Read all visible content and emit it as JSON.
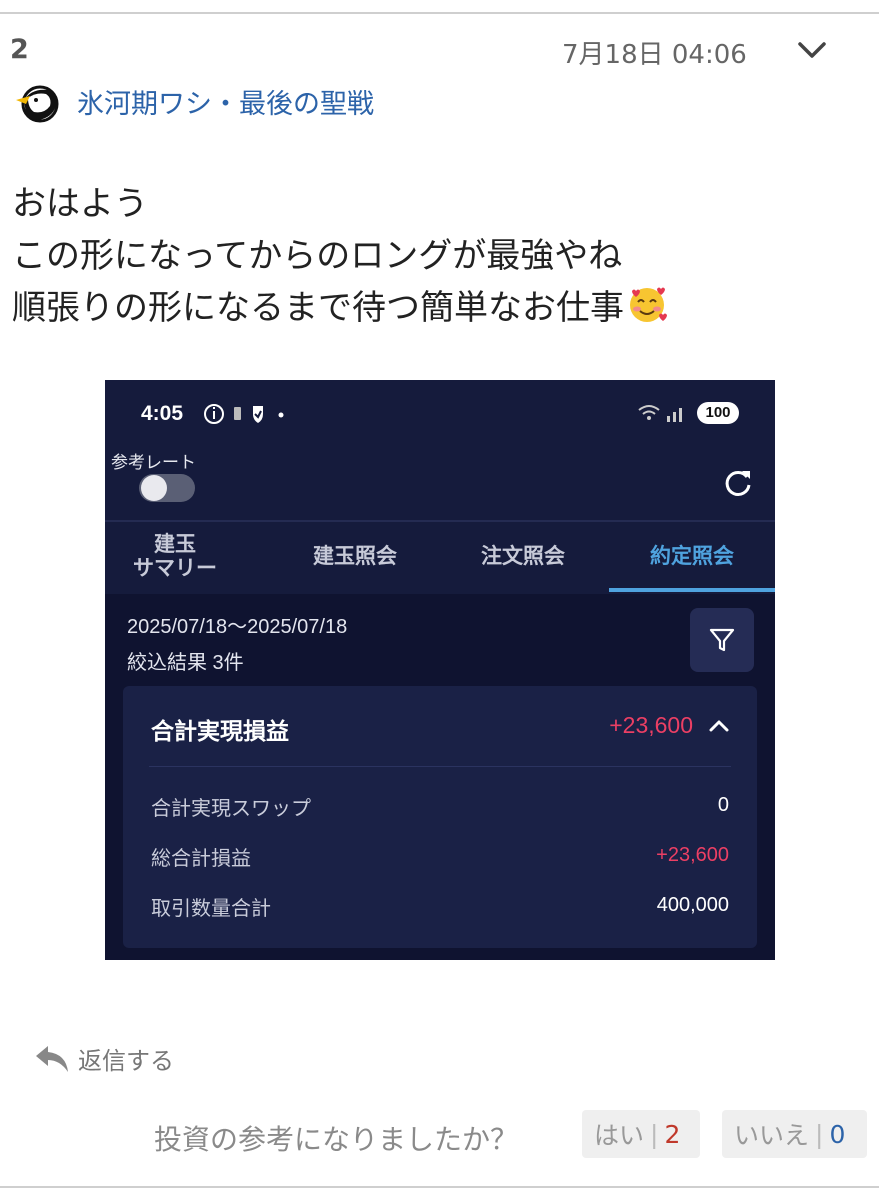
{
  "post": {
    "number": "2",
    "date": "7月18日 04:06",
    "author": "氷河期ワシ・最後の聖戦",
    "body_lines": [
      "おはよう",
      "この形になってからのロングが最強やね",
      "順張りの形になるまで待つ簡単なお仕事"
    ],
    "emoji_icon": "smiling-face-with-hearts-icon"
  },
  "screenshot": {
    "status_time": "4:05",
    "battery": "100",
    "ref_rate_label": "参考レート",
    "toggle_on": false,
    "tabs": [
      {
        "line1": "建玉",
        "line2": "サマリー",
        "active": false
      },
      {
        "line1": "建玉照会",
        "line2": "",
        "active": true
      },
      {
        "line1": "注文照会",
        "line2": "",
        "active": false
      },
      {
        "line1": "約定照会",
        "line2": "",
        "active": true
      }
    ],
    "date_range": "2025/07/18〜2025/07/18",
    "filter_result": "絞込結果  3件",
    "summary": {
      "title": "合計実現損益",
      "total": "+23,600",
      "rows": [
        {
          "label": "合計実現スワップ",
          "value": "0"
        },
        {
          "label": "総合計損益",
          "value": "+23,600"
        },
        {
          "label": "取引数量合計",
          "value": "400,000"
        }
      ]
    },
    "colors": {
      "positive": "#ec3f64",
      "active_tab": "#4fa3df",
      "background": "#151b3c"
    }
  },
  "actions": {
    "reply_label": "返信する",
    "vote_question": "投資の参考になりましたか？",
    "vote_yes_label": "はい",
    "vote_yes_count": "2",
    "vote_no_label": "いいえ",
    "vote_no_count": "0"
  }
}
